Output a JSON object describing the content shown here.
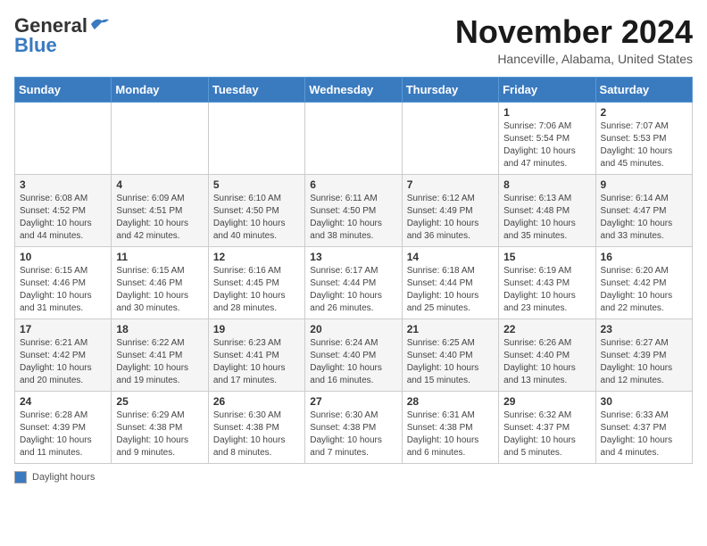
{
  "header": {
    "logo_line1": "General",
    "logo_line2": "Blue",
    "month": "November 2024",
    "location": "Hanceville, Alabama, United States"
  },
  "weekdays": [
    "Sunday",
    "Monday",
    "Tuesday",
    "Wednesday",
    "Thursday",
    "Friday",
    "Saturday"
  ],
  "weeks": [
    [
      {
        "day": "",
        "info": ""
      },
      {
        "day": "",
        "info": ""
      },
      {
        "day": "",
        "info": ""
      },
      {
        "day": "",
        "info": ""
      },
      {
        "day": "",
        "info": ""
      },
      {
        "day": "1",
        "info": "Sunrise: 7:06 AM\nSunset: 5:54 PM\nDaylight: 10 hours and 47 minutes."
      },
      {
        "day": "2",
        "info": "Sunrise: 7:07 AM\nSunset: 5:53 PM\nDaylight: 10 hours and 45 minutes."
      }
    ],
    [
      {
        "day": "3",
        "info": "Sunrise: 6:08 AM\nSunset: 4:52 PM\nDaylight: 10 hours and 44 minutes."
      },
      {
        "day": "4",
        "info": "Sunrise: 6:09 AM\nSunset: 4:51 PM\nDaylight: 10 hours and 42 minutes."
      },
      {
        "day": "5",
        "info": "Sunrise: 6:10 AM\nSunset: 4:50 PM\nDaylight: 10 hours and 40 minutes."
      },
      {
        "day": "6",
        "info": "Sunrise: 6:11 AM\nSunset: 4:50 PM\nDaylight: 10 hours and 38 minutes."
      },
      {
        "day": "7",
        "info": "Sunrise: 6:12 AM\nSunset: 4:49 PM\nDaylight: 10 hours and 36 minutes."
      },
      {
        "day": "8",
        "info": "Sunrise: 6:13 AM\nSunset: 4:48 PM\nDaylight: 10 hours and 35 minutes."
      },
      {
        "day": "9",
        "info": "Sunrise: 6:14 AM\nSunset: 4:47 PM\nDaylight: 10 hours and 33 minutes."
      }
    ],
    [
      {
        "day": "10",
        "info": "Sunrise: 6:15 AM\nSunset: 4:46 PM\nDaylight: 10 hours and 31 minutes."
      },
      {
        "day": "11",
        "info": "Sunrise: 6:15 AM\nSunset: 4:46 PM\nDaylight: 10 hours and 30 minutes."
      },
      {
        "day": "12",
        "info": "Sunrise: 6:16 AM\nSunset: 4:45 PM\nDaylight: 10 hours and 28 minutes."
      },
      {
        "day": "13",
        "info": "Sunrise: 6:17 AM\nSunset: 4:44 PM\nDaylight: 10 hours and 26 minutes."
      },
      {
        "day": "14",
        "info": "Sunrise: 6:18 AM\nSunset: 4:44 PM\nDaylight: 10 hours and 25 minutes."
      },
      {
        "day": "15",
        "info": "Sunrise: 6:19 AM\nSunset: 4:43 PM\nDaylight: 10 hours and 23 minutes."
      },
      {
        "day": "16",
        "info": "Sunrise: 6:20 AM\nSunset: 4:42 PM\nDaylight: 10 hours and 22 minutes."
      }
    ],
    [
      {
        "day": "17",
        "info": "Sunrise: 6:21 AM\nSunset: 4:42 PM\nDaylight: 10 hours and 20 minutes."
      },
      {
        "day": "18",
        "info": "Sunrise: 6:22 AM\nSunset: 4:41 PM\nDaylight: 10 hours and 19 minutes."
      },
      {
        "day": "19",
        "info": "Sunrise: 6:23 AM\nSunset: 4:41 PM\nDaylight: 10 hours and 17 minutes."
      },
      {
        "day": "20",
        "info": "Sunrise: 6:24 AM\nSunset: 4:40 PM\nDaylight: 10 hours and 16 minutes."
      },
      {
        "day": "21",
        "info": "Sunrise: 6:25 AM\nSunset: 4:40 PM\nDaylight: 10 hours and 15 minutes."
      },
      {
        "day": "22",
        "info": "Sunrise: 6:26 AM\nSunset: 4:40 PM\nDaylight: 10 hours and 13 minutes."
      },
      {
        "day": "23",
        "info": "Sunrise: 6:27 AM\nSunset: 4:39 PM\nDaylight: 10 hours and 12 minutes."
      }
    ],
    [
      {
        "day": "24",
        "info": "Sunrise: 6:28 AM\nSunset: 4:39 PM\nDaylight: 10 hours and 11 minutes."
      },
      {
        "day": "25",
        "info": "Sunrise: 6:29 AM\nSunset: 4:38 PM\nDaylight: 10 hours and 9 minutes."
      },
      {
        "day": "26",
        "info": "Sunrise: 6:30 AM\nSunset: 4:38 PM\nDaylight: 10 hours and 8 minutes."
      },
      {
        "day": "27",
        "info": "Sunrise: 6:30 AM\nSunset: 4:38 PM\nDaylight: 10 hours and 7 minutes."
      },
      {
        "day": "28",
        "info": "Sunrise: 6:31 AM\nSunset: 4:38 PM\nDaylight: 10 hours and 6 minutes."
      },
      {
        "day": "29",
        "info": "Sunrise: 6:32 AM\nSunset: 4:37 PM\nDaylight: 10 hours and 5 minutes."
      },
      {
        "day": "30",
        "info": "Sunrise: 6:33 AM\nSunset: 4:37 PM\nDaylight: 10 hours and 4 minutes."
      }
    ]
  ],
  "legend": {
    "daylight_label": "Daylight hours"
  }
}
